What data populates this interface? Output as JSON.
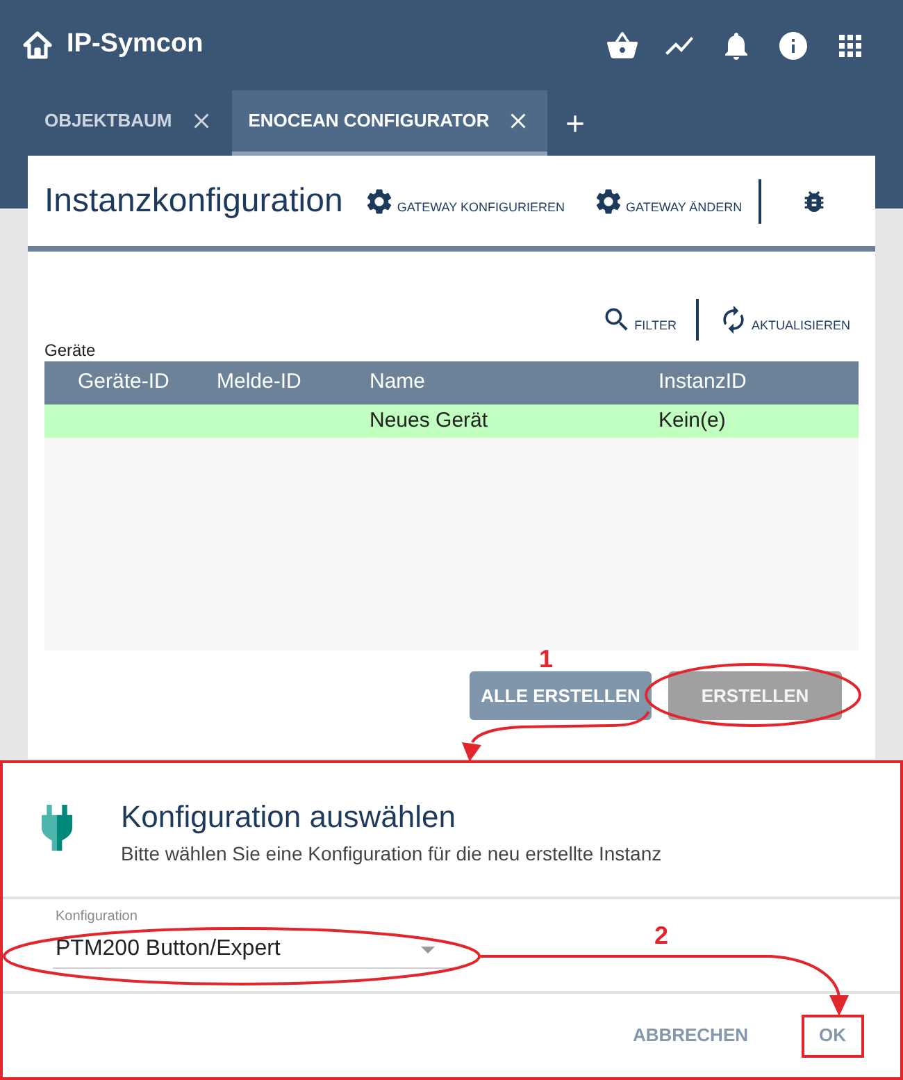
{
  "header": {
    "title": "IP-Symcon"
  },
  "tabs": [
    {
      "label": "OBJEKTBAUM",
      "selected": false
    },
    {
      "label": "ENOCEAN CONFIGURATOR",
      "selected": true
    }
  ],
  "panel": {
    "title": "Instanzkonfiguration",
    "actions": [
      "GATEWAY KONFIGURIEREN",
      "GATEWAY ÄNDERN"
    ],
    "toolbar": [
      {
        "kind": "filter",
        "label": "FILTER"
      },
      {
        "kind": "refresh",
        "label": "AKTUALISIEREN"
      }
    ],
    "table": {
      "label": "Geräte",
      "columns": [
        "Geräte-ID",
        "Melde-ID",
        "Name",
        "InstanzID"
      ],
      "rows": [
        {
          "color": "#c0ffc0",
          "name": "Neues Gerät",
          "instance_id": "Kein(e)"
        }
      ]
    },
    "buttons": [
      {
        "kind": "primary",
        "label": "ALLE ERSTELLEN"
      },
      {
        "kind": "secondary",
        "label": "ERSTELLEN"
      }
    ]
  },
  "dialog": {
    "title": "Konfiguration auswählen",
    "subtitle": "Bitte wählen Sie eine Konfiguration für die neu erstellte Instanz",
    "select": {
      "label": "Konfiguration",
      "value": "PTM200 Button/Expert"
    },
    "buttons": [
      "ABBRECHEN",
      "OK"
    ]
  },
  "annotations": [
    {
      "label": "1"
    },
    {
      "label": "2"
    }
  ]
}
